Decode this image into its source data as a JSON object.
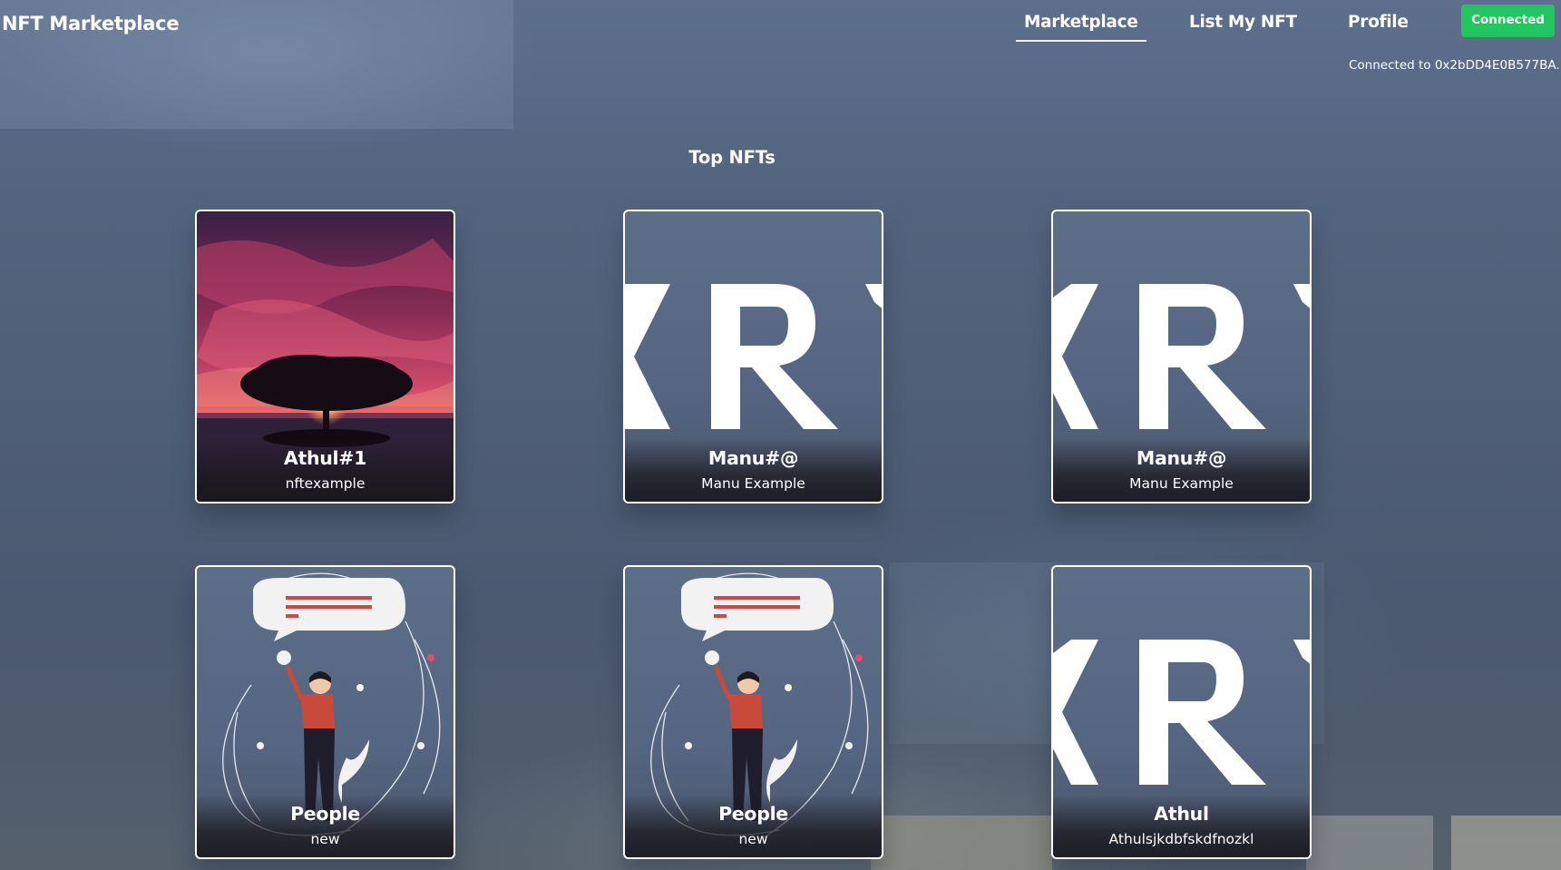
{
  "header": {
    "brand": "NFT Marketplace",
    "nav": [
      {
        "label": "Marketplace",
        "active": true
      },
      {
        "label": "List My NFT",
        "active": false
      },
      {
        "label": "Profile",
        "active": false
      }
    ],
    "connect_button": "Connected",
    "address_text": "Connected to 0x2bDD4E0B577BA..."
  },
  "main": {
    "title": "Top NFTs",
    "cards": [
      {
        "name": "Athul#1",
        "description": "nftexample",
        "image": "sunset-tree"
      },
      {
        "name": "Manu#@",
        "description": "Manu Example",
        "image": "krypto-logo"
      },
      {
        "name": "Manu#@",
        "description": "Manu Example",
        "image": "krypto-logo"
      },
      {
        "name": "People",
        "description": "new",
        "image": "people-illustration"
      },
      {
        "name": "People",
        "description": "new",
        "image": "people-illustration"
      },
      {
        "name": "Athul",
        "description": "Athulsjkdbfskdfnozkl",
        "image": "krypto-logo"
      }
    ]
  },
  "colors": {
    "accent_green": "#22c55e",
    "card_border": "#ffffff",
    "background": "#54657f"
  }
}
